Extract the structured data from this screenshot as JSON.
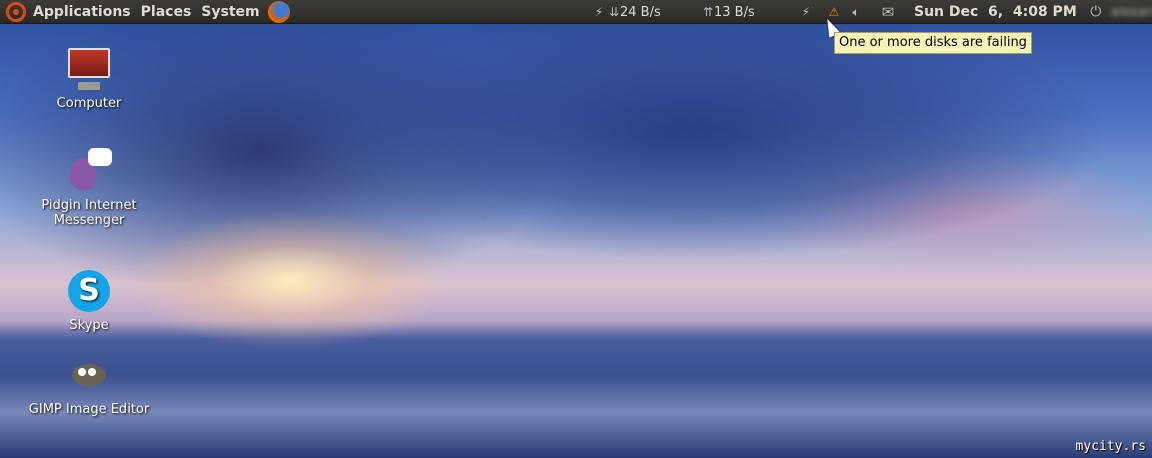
{
  "panel": {
    "menus": [
      "Applications",
      "Places",
      "System"
    ],
    "net_down": "24 B/s",
    "net_up": "13 B/s",
    "clock": "Sun Dec  6,  4:08 PM",
    "user": "alexandra"
  },
  "tooltip": "One or more disks are failing",
  "desktop_icons": [
    {
      "label_1": "Computer"
    },
    {
      "label_1": "Pidgin Internet",
      "label_2": "Messenger"
    },
    {
      "label_1": "Skype"
    },
    {
      "label_1": "GIMP Image Editor"
    }
  ],
  "watermark": "mycity.rs"
}
